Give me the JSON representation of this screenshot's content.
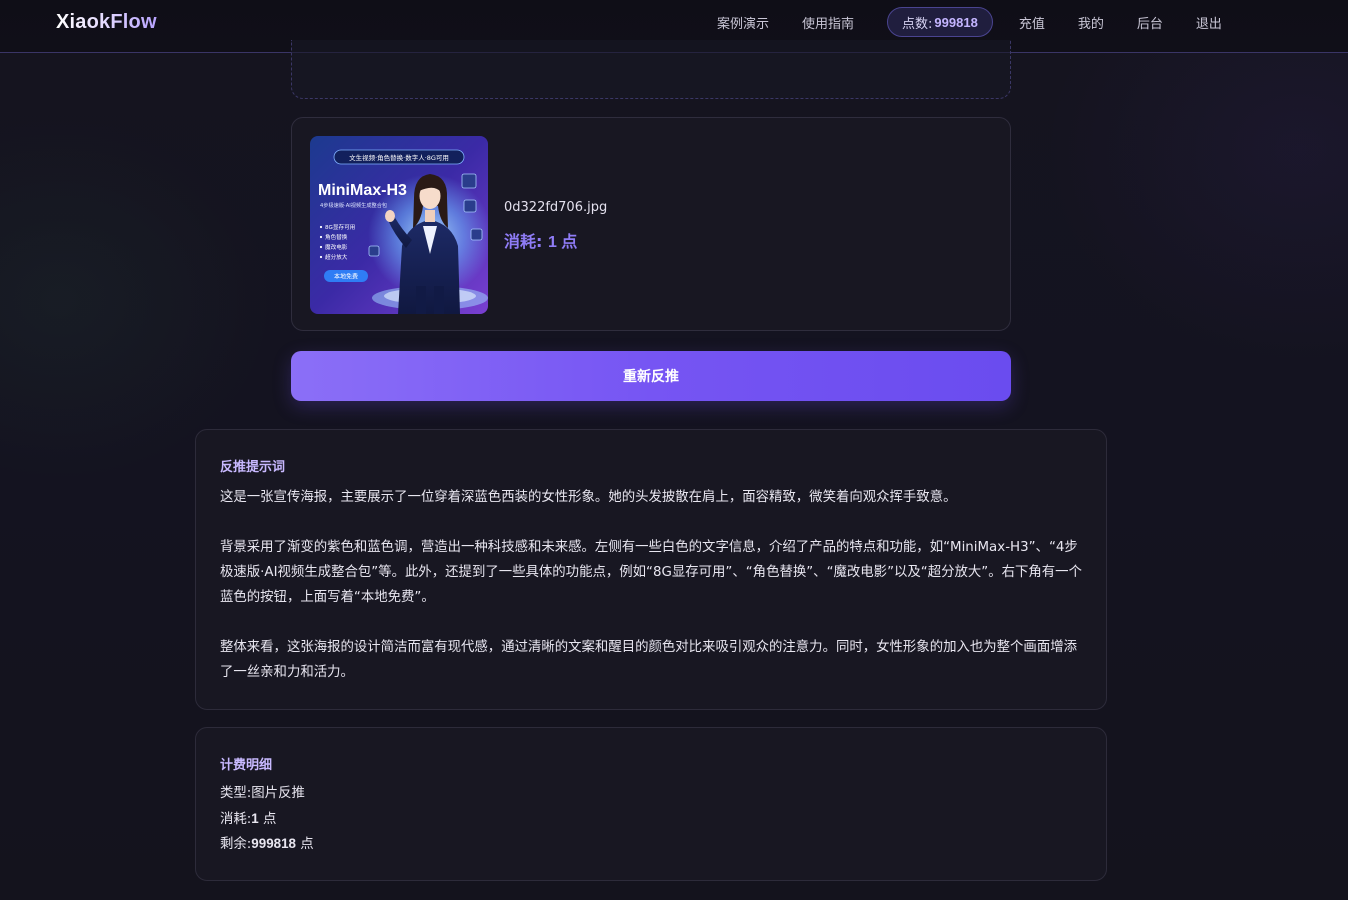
{
  "navbar": {
    "brand": "XiaokFlow",
    "links": {
      "demo": "案例演示",
      "guide": "使用指南",
      "recharge": "充值",
      "mine": "我的",
      "admin": "后台",
      "logout": "退出"
    },
    "points": {
      "label": "点数:",
      "value": "999818"
    }
  },
  "file_card": {
    "filename": "0d322fd706.jpg",
    "cost_label": "消耗:",
    "cost_value": "1 点",
    "thumbnail": {
      "top_banner": "文生视频·角色替换·数字人·8G可用",
      "title": "MiniMax-H3",
      "subtitle": "4步极速版·AI视频生成整合包",
      "bullets": [
        "8G显存可用",
        "角色替换",
        "魔改电影",
        "超分放大"
      ],
      "badge": "本地免费"
    }
  },
  "regen_button": {
    "label": "重新反推"
  },
  "prompt_panel": {
    "title": "反推提示词",
    "paragraphs": [
      "这是一张宣传海报，主要展示了一位穿着深蓝色西装的女性形象。她的头发披散在肩上，面容精致，微笑着向观众挥手致意。",
      "背景采用了渐变的紫色和蓝色调，营造出一种科技感和未来感。左侧有一些白色的文字信息，介绍了产品的特点和功能，如“MiniMax-H3”、“4步极速版·AI视频生成整合包”等。此外，还提到了一些具体的功能点，例如“8G显存可用”、“角色替换”、“魔改电影”以及“超分放大”。右下角有一个蓝色的按钮，上面写着“本地免费”。",
      "整体来看，这张海报的设计简洁而富有现代感，通过清晰的文案和醒目的颜色对比来吸引观众的注意力。同时，女性形象的加入也为整个画面增添了一丝亲和力和活力。"
    ]
  },
  "billing_panel": {
    "title": "计费明细",
    "type_label": "类型:",
    "type_value": "图片反推",
    "cost_label": "消耗:",
    "cost_num": "1",
    "remain_label": "剩余:",
    "remain_num": "999818",
    "unit": "点"
  },
  "colors": {
    "accent": "#7a5cf4",
    "accent_text": "#c8b9ff",
    "cost_text": "#8f7cf6",
    "background": "#14131d",
    "card": "#181722"
  }
}
